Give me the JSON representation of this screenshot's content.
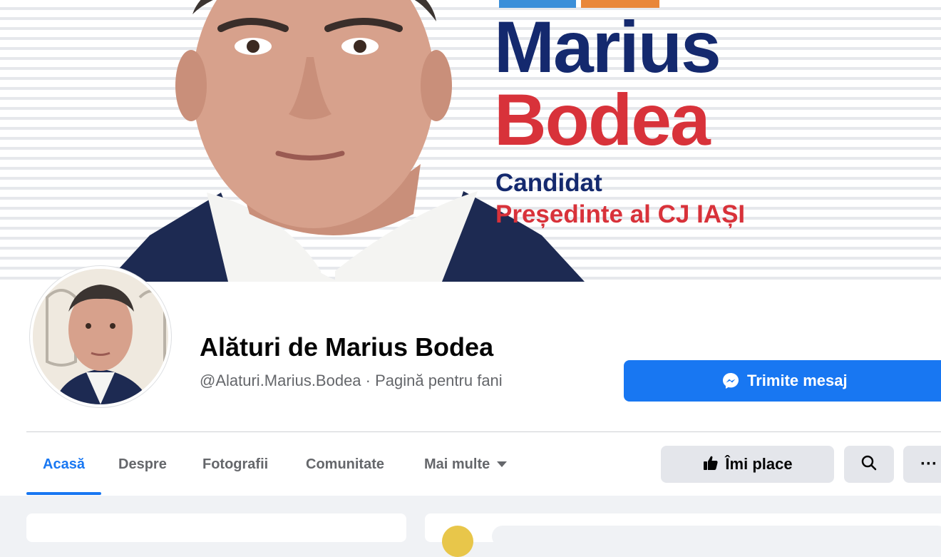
{
  "cover": {
    "name_first": "Marius",
    "name_last": "Bodea",
    "line_1": "Candidat",
    "line_2": "Președinte al CJ IAȘI",
    "colors": {
      "navy": "#14296e",
      "red": "#d8323a",
      "blue_tag": "#3b8fd9",
      "orange_tag": "#e9873a"
    }
  },
  "page": {
    "name": "Alături de Marius Bodea",
    "handle_and_category": "@Alaturi.Marius.Bodea · Pagină pentru fani"
  },
  "actions": {
    "message_label": "Trimite mesaj",
    "message_icon": "messenger-icon",
    "like_label": "Îmi place",
    "like_icon": "thumbs-up-icon",
    "search_icon": "search-icon",
    "more_label": "···"
  },
  "tabs": [
    {
      "label": "Acasă",
      "active": true
    },
    {
      "label": "Despre"
    },
    {
      "label": "Fotografii"
    },
    {
      "label": "Comunitate"
    },
    {
      "label": "Mai multe"
    }
  ],
  "colors": {
    "accent": "#1877f2",
    "text": "#050505",
    "secondary_text": "#65676b",
    "button_gray": "#e4e6eb"
  }
}
